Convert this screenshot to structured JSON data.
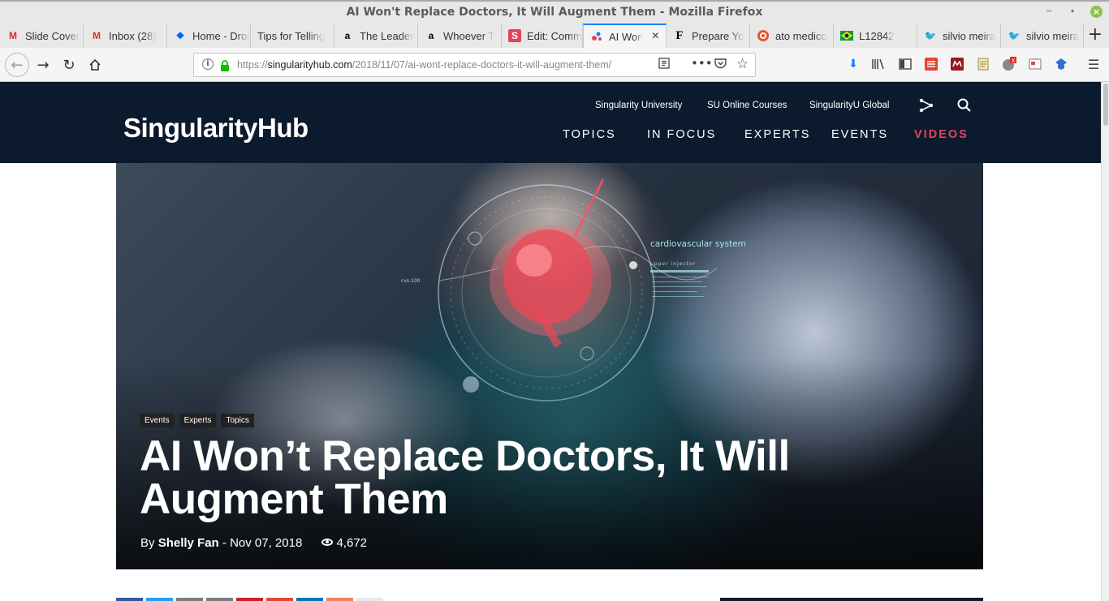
{
  "window": {
    "title": "AI Won't Replace Doctors, It Will Augment Them - Mozilla Firefox"
  },
  "tabs": [
    {
      "label": "Slide Cover",
      "icon": "gmail-icon"
    },
    {
      "label": "Inbox (28)",
      "icon": "gmail-icon"
    },
    {
      "label": "Home - Dropbox",
      "icon": "dropbox-icon"
    },
    {
      "label": "Tips for Telling",
      "icon": ""
    },
    {
      "label": "The Leader",
      "icon": "amazon-icon"
    },
    {
      "label": "Whoever T",
      "icon": "amazon-icon"
    },
    {
      "label": "Edit: Comm",
      "icon": "s-icon"
    },
    {
      "label": "AI Won",
      "icon": "singularityhub-icon",
      "active": true
    },
    {
      "label": "Prepare Yo",
      "icon": "f-icon"
    },
    {
      "label": "ato medico",
      "icon": "duckduckgo-icon"
    },
    {
      "label": "L12842",
      "icon": "flag-icon"
    },
    {
      "label": "silvio meira",
      "icon": "twitter-icon"
    },
    {
      "label": "silvio meira",
      "icon": "twitter-icon"
    }
  ],
  "url": {
    "prefix": "https://",
    "domain": "singularityhub.com",
    "path": "/2018/11/07/ai-wont-replace-doctors-it-will-augment-them/"
  },
  "site": {
    "logo": "SingularityHub",
    "top_links": [
      "Singularity University",
      "SU Online Courses",
      "SingularityU Global"
    ],
    "nav": [
      "TOPICS",
      "IN FOCUS",
      "EXPERTS",
      "EVENTS",
      "VIDEOS"
    ]
  },
  "article": {
    "categories": [
      "Events",
      "Experts",
      "Topics"
    ],
    "title": "AI Won’t Replace Doctors, It Will Augment Them",
    "by_label": "By",
    "author": "Shelly Fan",
    "separator": "-",
    "date": "Nov 07, 2018",
    "views": "4,672"
  },
  "hero_overlay": {
    "label": "cardiovascular system",
    "sublabel": "upper injector",
    "readout": "cvs-100"
  },
  "colors": {
    "header_bg": "#0c1a2e",
    "videos_accent": "#e0445d",
    "tab_active_accent": "#0a84ff"
  }
}
